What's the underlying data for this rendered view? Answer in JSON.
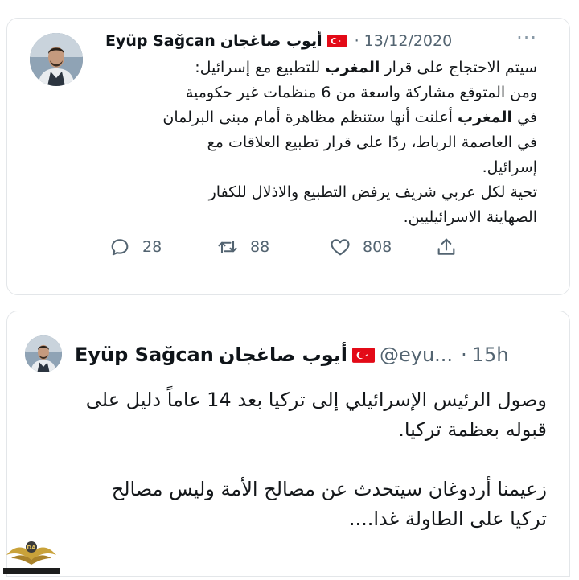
{
  "tweet1": {
    "display_name": "Eyüp Sağcan",
    "display_name_ar": "أيوب صاغجان",
    "separator": "·",
    "date": "13/12/2020",
    "more_icon": "more-horizontal-icon",
    "text_lines": [
      "سيتم الاحتجاج على قرار __المغرب__ للتطبيع مع إسرائيل:",
      "ومن المتوقع مشاركة واسعة من 6 منظمات غير حكومية",
      "في __المغرب__ أعلنت أنها ستنظم مظاهرة أمام مبنى البرلمان",
      "في العاصمة الرباط، ردًا على قرار تطبيع العلاقات مع",
      "إسرائيل.",
      "تحية لكل عربي شريف يرفض التطبيع والاذلال للكفار",
      "الصهاينة الاسرائيليين."
    ],
    "actions": {
      "reply_count": "28",
      "retweet_count": "88",
      "like_count": "808"
    }
  },
  "tweet2": {
    "display_name": "Eyüp Sağcan",
    "display_name_ar": "أيوب صاغجان",
    "handle": "@eyu...",
    "separator": "·",
    "time": "15h",
    "text_lines": [
      "وصول الرئيس الإسرائيلي إلى تركيا بعد 14 عاماً دليل على",
      "قبوله بعظمة تركيا.",
      "",
      "زعيمنا أردوغان سيتحدث عن مصالح الأمة وليس مصالح",
      "تركيا على الطاولة غدا...."
    ]
  },
  "watermark": {
    "logo_text": "ARAB DEFENSE FORUM"
  },
  "colors": {
    "text": "#0f1419",
    "secondary": "#536471",
    "border": "#e3e6e9",
    "flag_red": "#e30a17"
  }
}
